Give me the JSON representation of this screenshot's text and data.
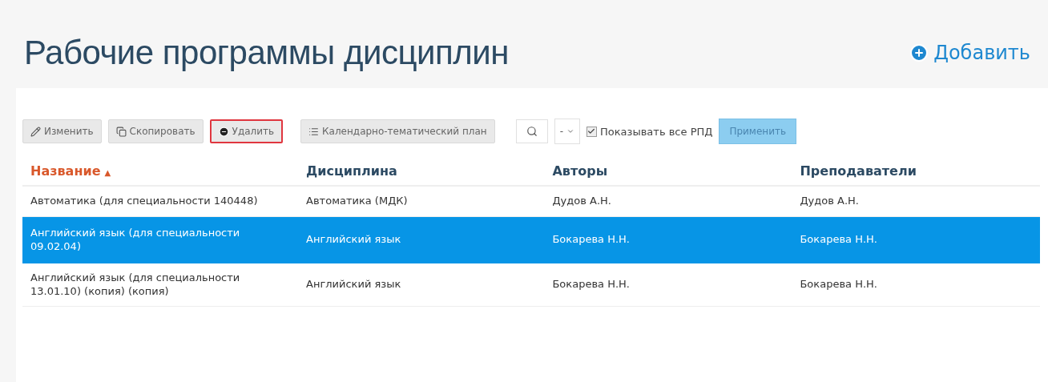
{
  "page_title": "Рабочие программы дисциплин",
  "add_link": "Добавить",
  "toolbar": {
    "buttons": [
      {
        "kind": "edit",
        "label": "Изменить",
        "highlighted": false
      },
      {
        "kind": "copy",
        "label": "Скопировать",
        "highlighted": false
      },
      {
        "kind": "delete",
        "label": "Удалить",
        "highlighted": true
      },
      {
        "kind": "plan",
        "label": "Календарно-тематический план",
        "highlighted": false
      }
    ],
    "select_value": "-",
    "show_all": {
      "label": "Показывать все РПД",
      "checked": true
    },
    "apply": "Применить"
  },
  "table": {
    "columns": [
      {
        "label": "Название",
        "sorted": true,
        "sort_mark": "▲"
      },
      {
        "label": "Дисциплина",
        "sorted": false
      },
      {
        "label": "Авторы",
        "sorted": false
      },
      {
        "label": "Преподаватели",
        "sorted": false
      }
    ],
    "rows": [
      {
        "selected": false,
        "cells": [
          "Автоматика (для специальности 140448)",
          "Автоматика (МДК)",
          "Дудов А.Н.",
          "Дудов А.Н."
        ]
      },
      {
        "selected": true,
        "cells": [
          "Английский язык (для специальности 09.02.04)",
          "Английский язык",
          "Бокарева Н.Н.",
          "Бокарева Н.Н."
        ]
      },
      {
        "selected": false,
        "cells": [
          "Английский язык (для специальности 13.01.10) (копия) (копия)",
          "Английский язык",
          "Бокарева Н.Н.",
          "Бокарева Н.Н."
        ]
      }
    ]
  }
}
